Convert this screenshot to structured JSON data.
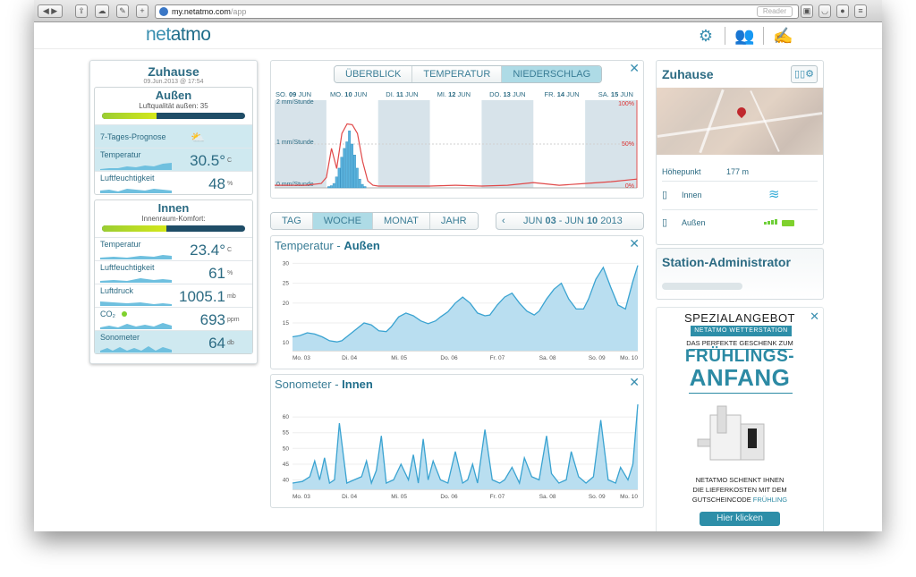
{
  "browser": {
    "url_host": "my.netatmo.com",
    "url_path": "/app",
    "reader_label": "Reader"
  },
  "header": {
    "logo_prefix": "net",
    "logo_suffix": "atmo"
  },
  "left": {
    "home_title": "Zuhause",
    "home_date": "09.Jun.2013 @ 17:54",
    "outdoor": {
      "title": "Außen",
      "quality_label": "Luftqualität außen: 35",
      "quality_fraction": 0.38,
      "forecast_label": "7-Tages-Prognose",
      "temp_label": "Temperatur",
      "temp_value": "30.5°",
      "temp_unit": "C",
      "hum_label": "Luftfeuchtigkeit",
      "hum_value": "48",
      "hum_unit": "%"
    },
    "indoor": {
      "title": "Innen",
      "comfort_label": "Innenraum-Komfort:",
      "comfort_fraction": 0.45,
      "temp_label": "Temperatur",
      "temp_value": "23.4°",
      "temp_unit": "C",
      "hum_label": "Luftfeuchtigkeit",
      "hum_value": "61",
      "hum_unit": "%",
      "press_label": "Luftdruck",
      "press_value": "1005.1",
      "press_unit": "mb",
      "co2_label": "CO₂",
      "co2_value": "693",
      "co2_unit": "ppm",
      "sono_label": "Sonometer",
      "sono_value": "64",
      "sono_unit": "db"
    }
  },
  "forecast": {
    "tabs": [
      "ÜBERBLICK",
      "TEMPERATUR",
      "NIEDERSCHLAG"
    ],
    "active_tab": "NIEDERSCHLAG",
    "days": [
      {
        "pre": "SO. ",
        "num": "09",
        "post": " JUN"
      },
      {
        "pre": "MO. ",
        "num": "10",
        "post": " JUN"
      },
      {
        "pre": "DI. ",
        "num": "11",
        "post": " JUN"
      },
      {
        "pre": "MI. ",
        "num": "12",
        "post": " JUN"
      },
      {
        "pre": "DO. ",
        "num": "13",
        "post": " JUN"
      },
      {
        "pre": "FR. ",
        "num": "14",
        "post": " JUN"
      },
      {
        "pre": "SA. ",
        "num": "15",
        "post": " JUN"
      }
    ],
    "y_labels": [
      "2 mm/Stunde",
      "1 mm/Stunde",
      "0 mm/Stunde"
    ],
    "right_labels": [
      "100%",
      "50%",
      "0%"
    ]
  },
  "period": {
    "tabs": [
      "TAG",
      "WOCHE",
      "MONAT",
      "JAHR"
    ],
    "active": "WOCHE",
    "range_prefix": "JUN ",
    "range_from": "03",
    "range_mid": " - JUN ",
    "range_to": "10",
    "range_year": " 2013"
  },
  "temp_chart": {
    "title_a": "Temperatur - ",
    "title_b": "Außen",
    "y_ticks": [
      "30",
      "25",
      "20",
      "15",
      "10"
    ],
    "x_ticks": [
      "Mo. 03",
      "Di. 04",
      "Mi. 05",
      "Do. 06",
      "Fr. 07",
      "Sa. 08",
      "So. 09",
      "Mo. 10"
    ]
  },
  "sono_chart": {
    "title_a": "Sonometer - ",
    "title_b": "Innen",
    "y_ticks": [
      "60",
      "55",
      "50",
      "45",
      "40"
    ],
    "x_ticks": [
      "Mo. 03",
      "Di. 04",
      "Mi. 05",
      "Do. 06",
      "Fr. 07",
      "Sa. 08",
      "So. 09",
      "Mo. 10"
    ]
  },
  "station": {
    "title": "Zuhause",
    "altitude_label": "Höhepunkt",
    "altitude_value": "177 m",
    "indoor_label": "Innen",
    "outdoor_label": "Außen"
  },
  "admin": {
    "title": "Station-Administrator"
  },
  "ad": {
    "line1": "SPEZIALANGEBOT",
    "line2": "NETATMO WETTERSTATION",
    "line3": "DAS PERFEKTE GESCHENK ZUM",
    "line4": "FRÜHLINGS-",
    "line5": "ANFANG",
    "line6a": "NETATMO SCHENKT IHNEN",
    "line6b": "DIE LIEFERKOSTEN MIT DEM",
    "line6c": "GUTSCHEINCODE ",
    "line6d": "FRÜHLING",
    "button": "Hier klicken"
  },
  "chart_data": [
    {
      "type": "bar",
      "title": "",
      "categories": [
        "SO. 09 JUN",
        "MO. 10 JUN",
        "DI. 11 JUN",
        "MI. 12 JUN",
        "DO. 13 JUN",
        "FR. 14 JUN",
        "SA. 15 JUN"
      ],
      "series": [
        {
          "name": "",
          "x": [
            1.05,
            1.1,
            1.15,
            1.2,
            1.25,
            1.3,
            1.35,
            1.4,
            1.45,
            1.5,
            1.55,
            1.6,
            1.65,
            1.7,
            1.75
          ],
          "values": [
            0.03,
            0.05,
            0.1,
            0.25,
            0.45,
            0.7,
            0.9,
            1.05,
            1.3,
            1.0,
            0.75,
            0.45,
            0.2,
            0.08,
            0.03
          ]
        }
      ],
      "line_percent": {
        "x": [
          0,
          0.3,
          0.6,
          0.9,
          1.0,
          1.1,
          1.2,
          1.3,
          1.4,
          1.5,
          1.6,
          1.7,
          1.8,
          1.9,
          2.0,
          2.5,
          3.0,
          3.5,
          4.0,
          4.5,
          5.0,
          5.5,
          6.0,
          6.5,
          7.0
        ],
        "values": [
          3,
          3,
          3,
          5,
          12,
          45,
          22,
          62,
          73,
          72,
          62,
          30,
          8,
          3,
          2,
          2,
          2,
          3,
          2,
          3,
          6,
          3,
          5,
          7,
          10
        ]
      },
      "ylim": [
        0,
        2
      ],
      "ylabel": "mm/Stunde"
    },
    {
      "type": "area",
      "title": "Temperatur - Außen",
      "x": [
        "Mo. 03",
        "Di. 04",
        "Mi. 05",
        "Do. 06",
        "Fr. 07",
        "Sa. 08",
        "So. 09",
        "Mo. 10"
      ],
      "values_x": [
        0,
        0.15,
        0.3,
        0.45,
        0.6,
        0.75,
        0.9,
        1.0,
        1.15,
        1.3,
        1.45,
        1.6,
        1.75,
        1.9,
        2.0,
        2.15,
        2.3,
        2.45,
        2.6,
        2.75,
        2.9,
        3.0,
        3.15,
        3.3,
        3.45,
        3.6,
        3.75,
        3.9,
        4.0,
        4.15,
        4.3,
        4.45,
        4.6,
        4.75,
        4.9,
        5.0,
        5.15,
        5.3,
        5.45,
        5.6,
        5.75,
        5.9,
        6.0,
        6.15,
        6.3,
        6.45,
        6.6,
        6.75,
        6.9,
        7.0
      ],
      "values": [
        11.5,
        11.8,
        12.5,
        12.2,
        11.5,
        10.5,
        10.2,
        10.5,
        12,
        13.5,
        15,
        14.5,
        13,
        12.8,
        14,
        16.5,
        17.5,
        16.8,
        15.5,
        14.8,
        15.5,
        16.5,
        17.8,
        20,
        21.5,
        20,
        17.5,
        16.8,
        17,
        19.5,
        21.5,
        22.5,
        20,
        18,
        17,
        18,
        21,
        23.5,
        25,
        21,
        18.5,
        18.5,
        21,
        26,
        29,
        24,
        19.5,
        18.5,
        25.5,
        29.5
      ],
      "ylim": [
        8,
        31
      ]
    },
    {
      "type": "area",
      "title": "Sonometer - Innen",
      "x": [
        "Mo. 03",
        "Di. 04",
        "Mi. 05",
        "Do. 06",
        "Fr. 07",
        "Sa. 08",
        "So. 09",
        "Mo. 10"
      ],
      "values_x": [
        0,
        0.2,
        0.35,
        0.45,
        0.55,
        0.65,
        0.75,
        0.85,
        0.95,
        1.1,
        1.25,
        1.4,
        1.5,
        1.6,
        1.7,
        1.8,
        1.9,
        2.05,
        2.2,
        2.35,
        2.45,
        2.55,
        2.65,
        2.75,
        2.85,
        3.0,
        3.15,
        3.3,
        3.45,
        3.55,
        3.65,
        3.75,
        3.9,
        4.05,
        4.2,
        4.3,
        4.45,
        4.6,
        4.7,
        4.85,
        5.0,
        5.15,
        5.25,
        5.4,
        5.55,
        5.65,
        5.8,
        5.95,
        6.1,
        6.25,
        6.4,
        6.55,
        6.65,
        6.8,
        6.9,
        7.0
      ],
      "values": [
        39,
        39.5,
        41,
        46,
        40,
        47,
        39,
        40,
        58,
        39,
        40,
        41,
        46,
        39,
        43,
        54,
        39,
        40,
        45,
        40,
        48,
        39,
        53,
        40,
        46,
        40,
        39,
        49,
        39,
        40,
        45,
        39,
        56,
        40,
        39,
        40,
        44,
        39,
        47,
        41,
        40,
        54,
        42,
        39,
        40,
        49,
        41,
        39,
        41,
        59,
        40,
        39,
        44,
        40,
        45,
        64
      ],
      "ylim": [
        37,
        66
      ]
    }
  ]
}
